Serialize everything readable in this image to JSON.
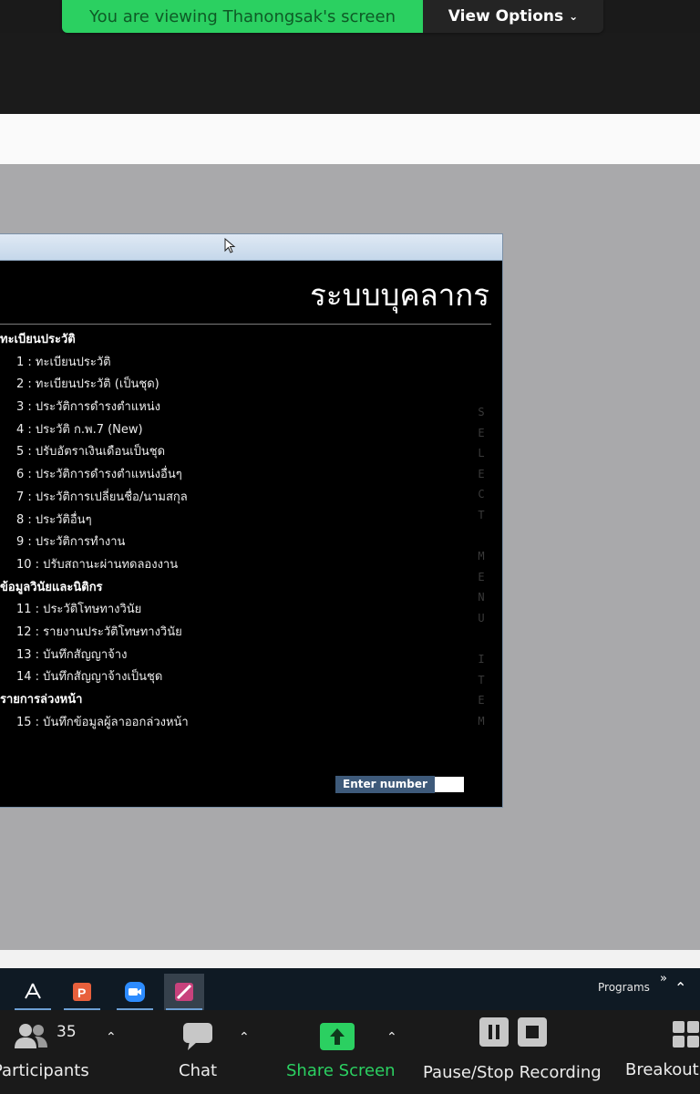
{
  "banner": {
    "viewing_text": "You are viewing Thanongsak's screen",
    "view_options_label": "View Options"
  },
  "app": {
    "title": "ระบบบุคลากร",
    "vertical_label": "SELECT MENU ITEM",
    "enter_label": "Enter number",
    "enter_value": "",
    "menu": [
      {
        "type": "group",
        "label": "ทะเบียนประวัติ"
      },
      {
        "type": "item",
        "label": "1 : ทะเบียนประวัติ"
      },
      {
        "type": "item",
        "label": "2 : ทะเบียนประวัติ (เป็นชุด)"
      },
      {
        "type": "item",
        "label": "3 : ประวัติการดำรงตำแหน่ง"
      },
      {
        "type": "item",
        "label": "4 : ประวัติ ก.พ.7 (New)"
      },
      {
        "type": "item",
        "label": "5 : ปรับอัตราเงินเดือนเป็นชุด"
      },
      {
        "type": "item",
        "label": "6 : ประวัติการดำรงตำแหน่งอื่นๆ"
      },
      {
        "type": "item",
        "label": "7 : ประวัติการเปลี่ยนชื่อ/นามสกุล"
      },
      {
        "type": "item",
        "label": "8 : ประวัติอื่นๆ"
      },
      {
        "type": "item",
        "label": "9 : ประวัติการทำงาน"
      },
      {
        "type": "item",
        "label": "10 : ปรับสถานะผ่านทดลองงาน"
      },
      {
        "type": "group",
        "label": "ข้อมูลวินัยและนิติกร"
      },
      {
        "type": "item",
        "label": "11 : ประวัติโทษทางวินัย"
      },
      {
        "type": "item",
        "label": "12 : รายงานประวัติโทษทางวินัย"
      },
      {
        "type": "item",
        "label": "13 : บันทึกสัญญาจ้าง"
      },
      {
        "type": "item",
        "label": "14 : บันทึกสัญญาจ้างเป็นชุด"
      },
      {
        "type": "group",
        "label": "รายการล่วงหน้า"
      },
      {
        "type": "item",
        "label": "15 : บันทึกข้อมูลผู้ลาออกล่วงหน้า"
      }
    ]
  },
  "taskbar": {
    "icons": [
      "pdf-icon",
      "powerpoint-icon",
      "zoom-icon",
      "access-icon"
    ],
    "programs_label": "Programs",
    "more_label": "»"
  },
  "toolbar": {
    "participants_label": "Participants",
    "participants_count": "35",
    "chat_label": "Chat",
    "share_label": "Share Screen",
    "record_label": "Pause/Stop Recording",
    "breakout_label": "Breakout",
    "share_color": "#2bd061"
  }
}
